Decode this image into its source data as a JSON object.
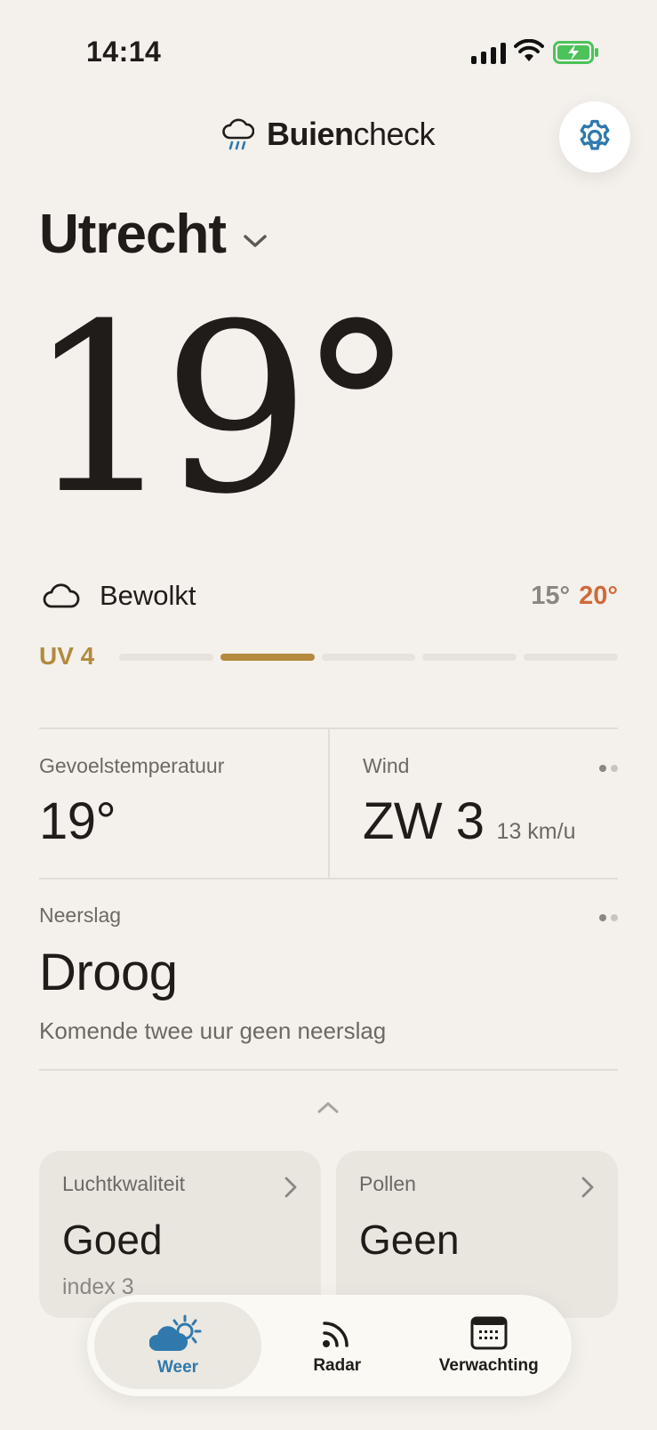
{
  "status_bar": {
    "time": "14:14"
  },
  "header": {
    "brand_bold": "Buien",
    "brand_regular": "check"
  },
  "location": {
    "city": "Utrecht"
  },
  "current": {
    "temperature": "19°",
    "condition": "Bewolkt",
    "low": "15°",
    "high": "20°",
    "uv_label": "UV 4",
    "uv_active_segment": 2,
    "uv_segments": 5
  },
  "details": {
    "feels_like_label": "Gevoelstemperatuur",
    "feels_like_value": "19°",
    "wind_label": "Wind",
    "wind_value": "ZW 3",
    "wind_speed": "13 km/u",
    "precip_label": "Neerslag",
    "precip_value": "Droog",
    "precip_desc": "Komende twee uur geen neerslag"
  },
  "cards": [
    {
      "label": "Luchtkwaliteit",
      "value": "Goed",
      "sub": "index 3"
    },
    {
      "label": "Pollen",
      "value": "Geen",
      "sub": ""
    }
  ],
  "nav": {
    "items": [
      {
        "label": "Weer",
        "icon": "weather-icon",
        "active": true
      },
      {
        "label": "Radar",
        "icon": "radar-icon",
        "active": false
      },
      {
        "label": "Verwachting",
        "icon": "calendar-icon",
        "active": false
      }
    ]
  },
  "colors": {
    "accent_blue": "#2f79ad",
    "uv_gold": "#b38a3e",
    "high_orange": "#d06a3b",
    "battery_green": "#4cc35a"
  }
}
